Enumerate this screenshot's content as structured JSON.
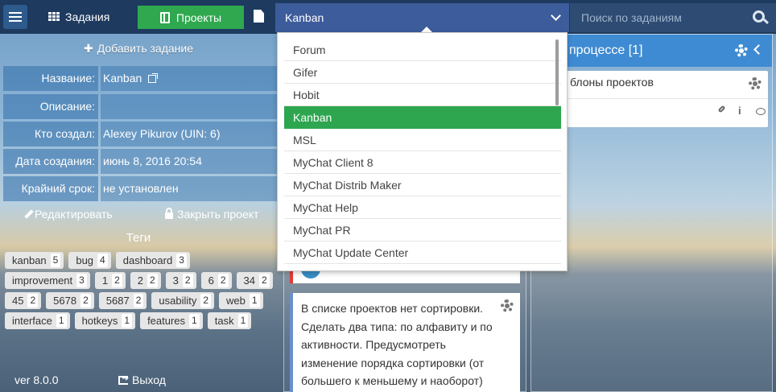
{
  "topbar": {
    "tasks_label": "Задания",
    "projects_label": "Проекты",
    "selected_project": "Kanban",
    "search_placeholder": "Поиск по заданиям"
  },
  "left": {
    "add_task": "Добавить задание",
    "fields": [
      {
        "label": "Название:",
        "value": "Kanban"
      },
      {
        "label": "Описание:",
        "value": ""
      },
      {
        "label": "Кто создал:",
        "value": "Alexey Pikurov (UIN: 6)"
      },
      {
        "label": "Дата создания:",
        "value": "июнь 8, 2016 20:54"
      },
      {
        "label": "Крайний срок:",
        "value": "не установлен"
      }
    ],
    "edit_label": "Редактировать",
    "close_label": "Закрыть проект",
    "tags_title": "Теги",
    "tags": [
      {
        "name": "kanban",
        "count": "5"
      },
      {
        "name": "bug",
        "count": "4"
      },
      {
        "name": "dashboard",
        "count": "3"
      },
      {
        "name": "improvement",
        "count": "3"
      },
      {
        "name": "1",
        "count": "2"
      },
      {
        "name": "2",
        "count": "2"
      },
      {
        "name": "3",
        "count": "2"
      },
      {
        "name": "6",
        "count": "2"
      },
      {
        "name": "34",
        "count": "2"
      },
      {
        "name": "45",
        "count": "2"
      },
      {
        "name": "5678",
        "count": "2"
      },
      {
        "name": "5687",
        "count": "2"
      },
      {
        "name": "usability",
        "count": "2"
      },
      {
        "name": "web",
        "count": "1"
      },
      {
        "name": "interface",
        "count": "1"
      },
      {
        "name": "hotkeys",
        "count": "1"
      },
      {
        "name": "features",
        "count": "1"
      },
      {
        "name": "task",
        "count": "1"
      }
    ],
    "version": "ver 8.0.0",
    "logout": "Выход"
  },
  "dropdown": {
    "items": [
      "Forum",
      "Gifer",
      "Hobit",
      "Kanban",
      "MSL",
      "MyChat Client 8",
      "MyChat Distrib Maker",
      "MyChat Help",
      "MyChat PR",
      "MyChat Update Center"
    ],
    "selected": "Kanban"
  },
  "middle": {
    "card_text": "В списке проектов нет сортировки. Сделать два типа: по алфавиту и по активности. Предусмотреть изменение порядка сортировки (от большего к меньшему и наоборот)"
  },
  "right": {
    "header": "процессе [1]",
    "card_title": "блоны проектов",
    "info_icon": "i"
  },
  "colors": {
    "topbar": "#1e3a5f",
    "projects_active": "#2fa84f",
    "selected_item": "#2ea64f",
    "column_header": "#3f8bd3"
  }
}
